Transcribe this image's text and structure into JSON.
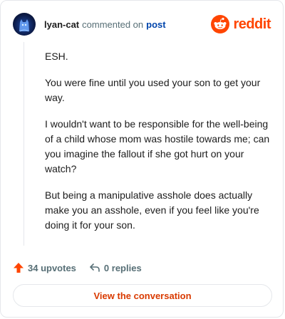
{
  "header": {
    "username": "lyan-cat",
    "action_text": "commented on",
    "post_label": "post",
    "brand": "reddit"
  },
  "comment": {
    "paragraphs": [
      "ESH.",
      "You were fine until you used your son to get your way.",
      "I wouldn't want to be responsible for the well-being of a child whose mom was hostile towards me; can you imagine the fallout if she got hurt on your watch?",
      "But being a manipulative asshole does actually make you an asshole, even if you feel like you're doing it for your son."
    ]
  },
  "footer": {
    "upvotes": "34 upvotes",
    "replies": "0 replies",
    "cta_label": "View the conversation"
  },
  "colors": {
    "brand": "#ff4500",
    "link": "#0045ac",
    "cta_text": "#d93a00"
  },
  "icons": {
    "avatar": "cat-avatar-icon",
    "brand": "reddit-snoo-icon",
    "upvote": "upvote-arrow-icon",
    "reply": "reply-arrow-icon"
  }
}
